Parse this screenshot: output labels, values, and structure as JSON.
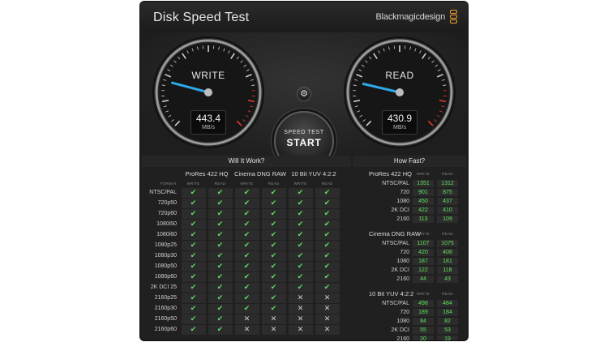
{
  "window": {
    "title": "Disk Speed Test",
    "brand": "Blackmagicdesign"
  },
  "write_gauge": {
    "label": "WRITE",
    "value": "443.4",
    "unit": "MB/s"
  },
  "read_gauge": {
    "label": "READ",
    "value": "430.9",
    "unit": "MB/s"
  },
  "start_button": {
    "top": "SPEED TEST",
    "main": "START"
  },
  "settings": {
    "icon": "gear-icon",
    "glyph": "⚙"
  },
  "will_it_work": {
    "title": "Will It Work?",
    "format_header": "FORMAT",
    "codecs": [
      "ProRes 422 HQ",
      "Cinema DNG RAW",
      "10 Bit YUV 4:2:2"
    ],
    "sub_headers": [
      "WRITE",
      "READ"
    ],
    "rows": [
      {
        "format": "NTSC/PAL",
        "cells": [
          "ok",
          "ok",
          "ok",
          "ok",
          "ok",
          "ok"
        ]
      },
      {
        "format": "720p50",
        "cells": [
          "ok",
          "ok",
          "ok",
          "ok",
          "ok",
          "ok"
        ]
      },
      {
        "format": "720p60",
        "cells": [
          "ok",
          "ok",
          "ok",
          "ok",
          "ok",
          "ok"
        ]
      },
      {
        "format": "1080i50",
        "cells": [
          "ok",
          "ok",
          "ok",
          "ok",
          "ok",
          "ok"
        ]
      },
      {
        "format": "1080i60",
        "cells": [
          "ok",
          "ok",
          "ok",
          "ok",
          "ok",
          "ok"
        ]
      },
      {
        "format": "1080p25",
        "cells": [
          "ok",
          "ok",
          "ok",
          "ok",
          "ok",
          "ok"
        ]
      },
      {
        "format": "1080p30",
        "cells": [
          "ok",
          "ok",
          "ok",
          "ok",
          "ok",
          "ok"
        ]
      },
      {
        "format": "1080p50",
        "cells": [
          "ok",
          "ok",
          "ok",
          "ok",
          "ok",
          "ok"
        ]
      },
      {
        "format": "1080p60",
        "cells": [
          "ok",
          "ok",
          "ok",
          "ok",
          "ok",
          "ok"
        ]
      },
      {
        "format": "2K DCI 25",
        "cells": [
          "ok",
          "ok",
          "ok",
          "ok",
          "ok",
          "ok"
        ]
      },
      {
        "format": "2160p25",
        "cells": [
          "ok",
          "ok",
          "ok",
          "ok",
          "no",
          "no"
        ]
      },
      {
        "format": "2160p30",
        "cells": [
          "ok",
          "ok",
          "ok",
          "ok",
          "no",
          "no"
        ]
      },
      {
        "format": "2160p50",
        "cells": [
          "ok",
          "ok",
          "no",
          "no",
          "no",
          "no"
        ]
      },
      {
        "format": "2160p60",
        "cells": [
          "ok",
          "ok",
          "no",
          "no",
          "no",
          "no"
        ]
      }
    ]
  },
  "how_fast": {
    "title": "How Fast?",
    "col_write": "WRITE",
    "col_read": "READ",
    "groups": [
      {
        "name": "ProRes 422 HQ",
        "rows": [
          {
            "label": "NTSC/PAL",
            "write": "1351",
            "read": "1312"
          },
          {
            "label": "720",
            "write": "901",
            "read": "875"
          },
          {
            "label": "1080",
            "write": "450",
            "read": "437"
          },
          {
            "label": "2K DCI",
            "write": "422",
            "read": "410"
          },
          {
            "label": "2160",
            "write": "113",
            "read": "109"
          }
        ]
      },
      {
        "name": "Cinema DNG RAW",
        "rows": [
          {
            "label": "NTSC/PAL",
            "write": "1107",
            "read": "1075"
          },
          {
            "label": "720",
            "write": "420",
            "read": "408"
          },
          {
            "label": "1080",
            "write": "187",
            "read": "181"
          },
          {
            "label": "2K DCI",
            "write": "122",
            "read": "118"
          },
          {
            "label": "2160",
            "write": "44",
            "read": "43"
          }
        ]
      },
      {
        "name": "10 Bit YUV 4:2:2",
        "rows": [
          {
            "label": "NTSC/PAL",
            "write": "498",
            "read": "484"
          },
          {
            "label": "720",
            "write": "189",
            "read": "184"
          },
          {
            "label": "1080",
            "write": "84",
            "read": "82"
          },
          {
            "label": "2K DCI",
            "write": "55",
            "read": "53"
          },
          {
            "label": "2160",
            "write": "20",
            "read": "19"
          }
        ]
      }
    ]
  },
  "colors": {
    "ok": "#5fe05f",
    "needle": "#2fa8e8",
    "redzone": "#e23a2a"
  }
}
